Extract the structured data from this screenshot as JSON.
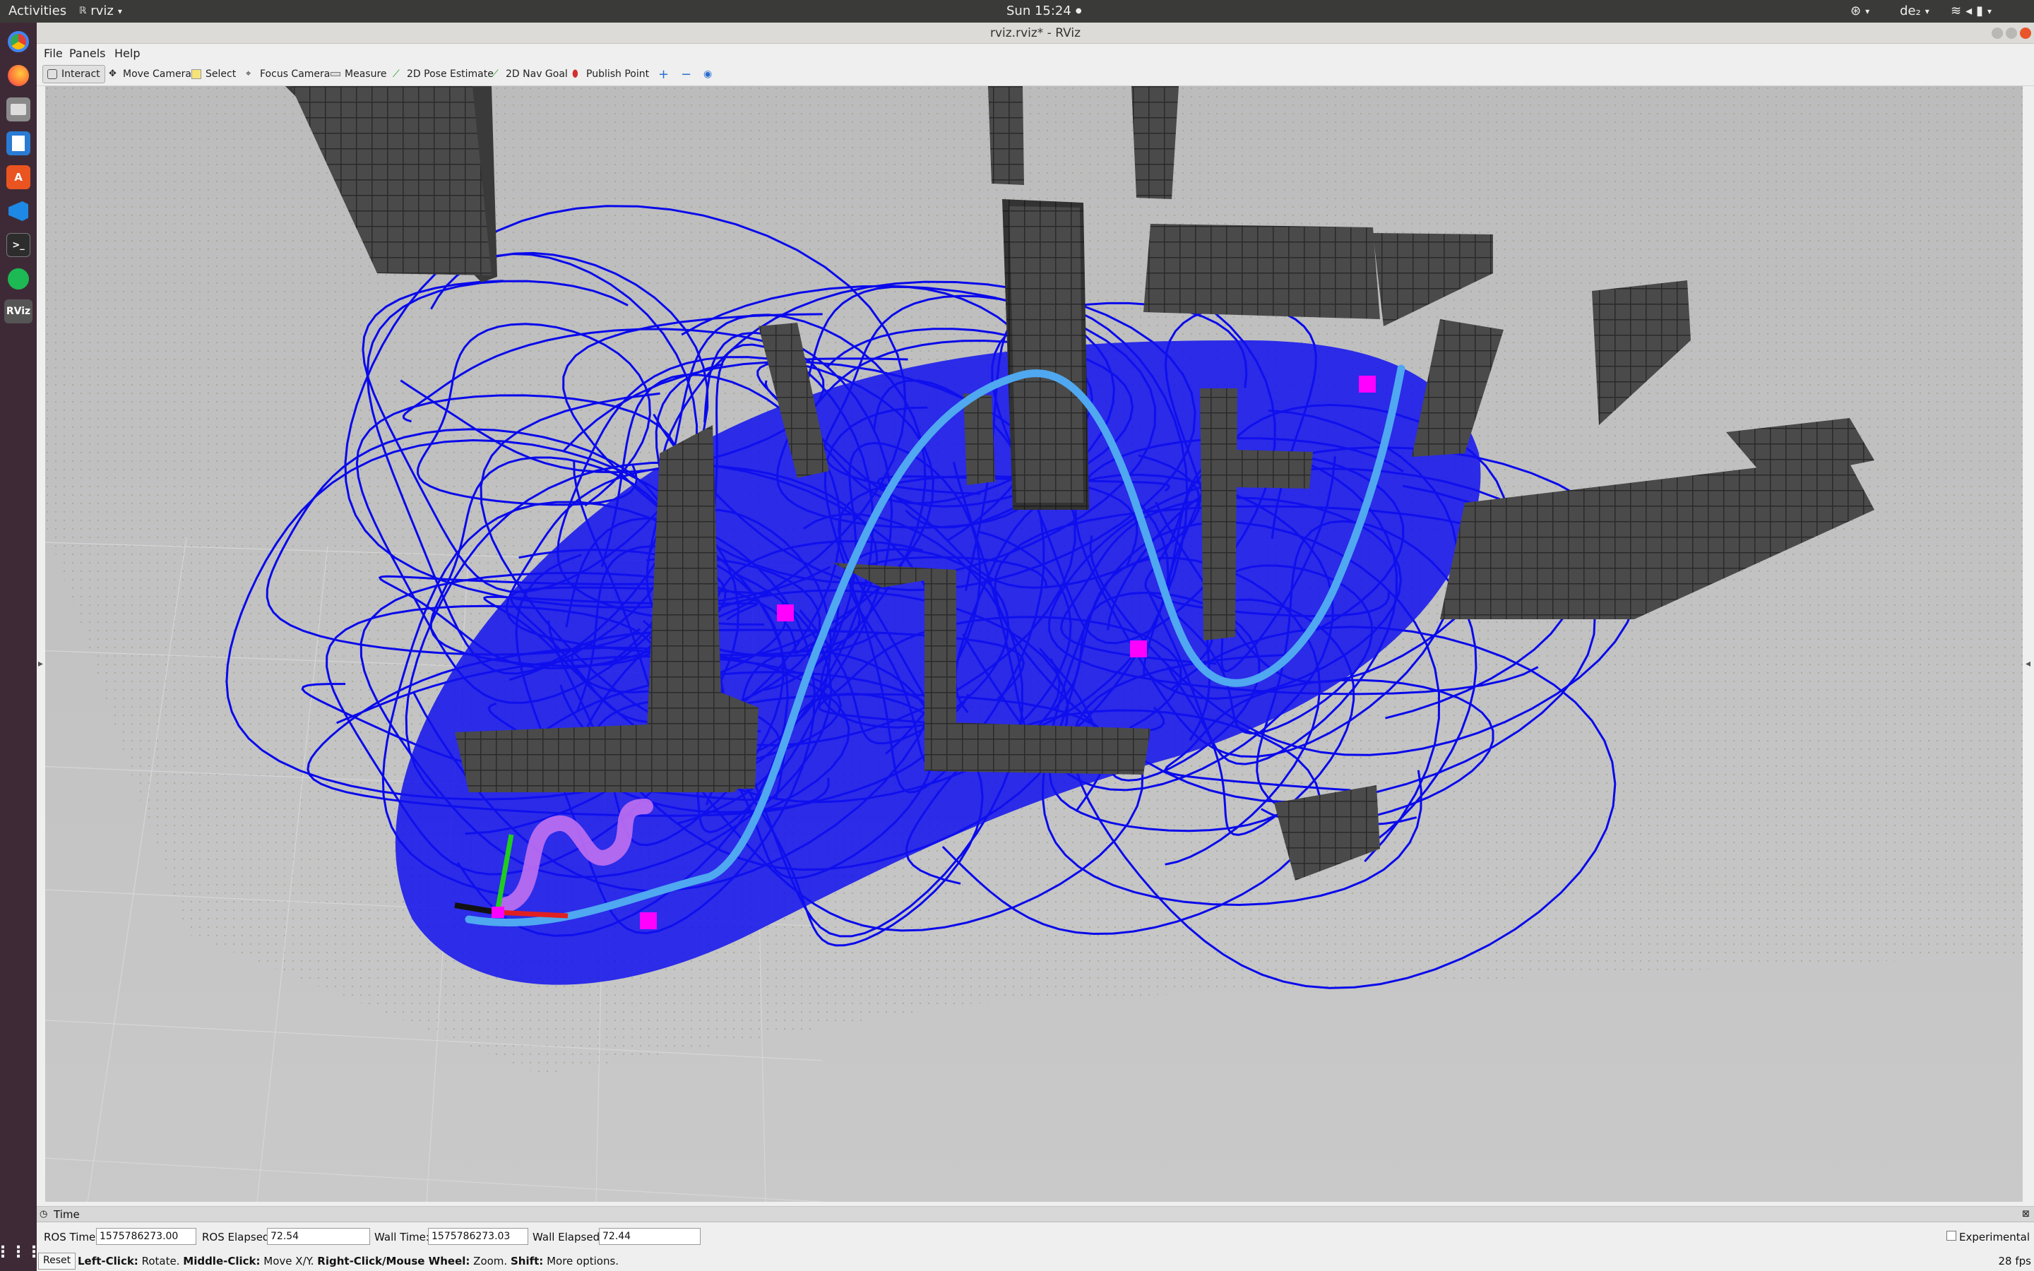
{
  "topbar": {
    "activities": "Activities",
    "app_name": "rviz",
    "clock": "Sun 15:24",
    "keyboard": "de₂"
  },
  "dock": {
    "items": [
      {
        "name": "chrome",
        "glyph": "",
        "color": "#e34133"
      },
      {
        "name": "firefox",
        "glyph": "",
        "color": "#ff7139"
      },
      {
        "name": "files",
        "glyph": "",
        "color": "#8c8c8c"
      },
      {
        "name": "writer",
        "glyph": "",
        "color": "#2a7bd3"
      },
      {
        "name": "software",
        "glyph": "A",
        "color": "#e95420"
      },
      {
        "name": "vscode",
        "glyph": "",
        "color": "#1e88e5"
      },
      {
        "name": "terminal",
        "glyph": ">_",
        "color": "#2d2d2d"
      },
      {
        "name": "spotify",
        "glyph": "",
        "color": "#1db954"
      },
      {
        "name": "rviz",
        "glyph": "RViz",
        "color": "#555555"
      }
    ]
  },
  "window": {
    "title": "rviz.rviz* - RViz"
  },
  "menu": {
    "file": "File",
    "panels": "Panels",
    "help": "Help"
  },
  "toolbar": {
    "interact": "Interact",
    "move_camera": "Move Camera",
    "select": "Select",
    "focus_camera": "Focus Camera",
    "measure": "Measure",
    "pose_estimate": "2D Pose Estimate",
    "nav_goal": "2D Nav Goal",
    "publish_point": "Publish Point"
  },
  "time_panel": {
    "header": "Time",
    "ros_time_label": "ROS Time:",
    "ros_time": "1575786273.00",
    "ros_elapsed_label": "ROS Elapsed:",
    "ros_elapsed": "72.54",
    "wall_time_label": "Wall Time:",
    "wall_time": "1575786273.03",
    "wall_elapsed_label": "Wall Elapsed:",
    "wall_elapsed": "72.44",
    "experimental": "Experimental"
  },
  "status": {
    "reset": "Reset",
    "left_click": "Left-Click:",
    "left_click_desc": "Rotate.",
    "middle_click": "Middle-Click:",
    "middle_click_desc": "Move X/Y.",
    "right_click": "Right-Click/Mouse Wheel:",
    "right_click_desc": "Zoom.",
    "shift": "Shift:",
    "shift_desc": "More options.",
    "fps": "28 fps"
  },
  "colors": {
    "trajectory": "#0000ee",
    "path": "#4fa8f0",
    "obstacle": "#4a4a4a",
    "waypoint": "#ff00ff",
    "robot_trail": "#c070f0"
  }
}
